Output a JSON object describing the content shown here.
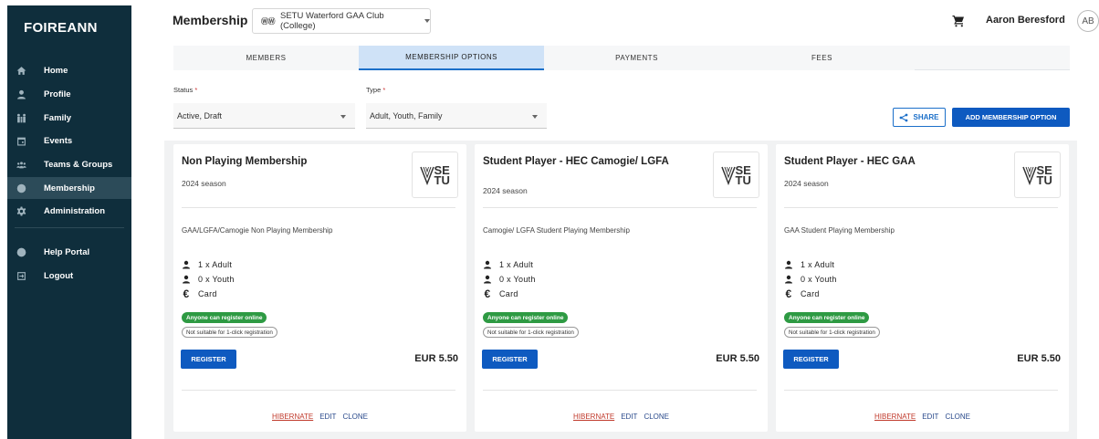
{
  "app": {
    "brand": "FOIREANN"
  },
  "sidebar": {
    "items": [
      {
        "label": "Home",
        "icon": "home-icon"
      },
      {
        "label": "Profile",
        "icon": "person-icon"
      },
      {
        "label": "Family",
        "icon": "family-icon"
      },
      {
        "label": "Events",
        "icon": "calendar-icon"
      },
      {
        "label": "Teams & Groups",
        "icon": "group-icon"
      },
      {
        "label": "Membership",
        "icon": "membership-icon",
        "active": true
      },
      {
        "label": "Administration",
        "icon": "gear-icon"
      },
      {
        "label": "Help Portal",
        "icon": "help-icon"
      },
      {
        "label": "Logout",
        "icon": "logout-icon"
      }
    ]
  },
  "header": {
    "title": "Membership",
    "club": "SETU Waterford GAA Club (College)",
    "user_name": "Aaron Beresford",
    "user_initials": "AB"
  },
  "tabs": [
    {
      "label": "MEMBERS"
    },
    {
      "label": "MEMBERSHIP OPTIONS",
      "active": true
    },
    {
      "label": "PAYMENTS"
    },
    {
      "label": "FEES"
    }
  ],
  "filters": {
    "status_label": "Status",
    "status_value": "Active, Draft",
    "type_label": "Type",
    "type_value": "Adult, Youth, Family",
    "required_mark": "*"
  },
  "actions": {
    "share_label": "SHARE",
    "add_label": "ADD MEMBERSHIP OPTION"
  },
  "cards": [
    {
      "title": "Non Playing Membership",
      "season": "2024 season",
      "description": "GAA/LGFA/Camogie Non Playing Membership",
      "adult": "1 x Adult",
      "youth": "0 x Youth",
      "payment": "Card",
      "badge_online": "Anyone can register online",
      "badge_oneclick": "Not suitable for 1-click registration",
      "register_label": "REGISTER",
      "price": "EUR 5.50",
      "hibernate": "HIBERNATE",
      "edit": "EDIT",
      "clone": "CLONE",
      "logo": "SETU"
    },
    {
      "title": "Student Player - HEC Camogie/ LGFA",
      "season": "2024 season",
      "description": "Camogie/ LGFA Student Playing Membership",
      "adult": "1 x Adult",
      "youth": "0 x Youth",
      "payment": "Card",
      "badge_online": "Anyone can register online",
      "badge_oneclick": "Not suitable for 1-click registration",
      "register_label": "REGISTER",
      "price": "EUR 5.50",
      "hibernate": "HIBERNATE",
      "edit": "EDIT",
      "clone": "CLONE",
      "logo": "SETU"
    },
    {
      "title": "Student Player - HEC GAA",
      "season": "2024 season",
      "description": "GAA Student Playing Membership",
      "adult": "1 x Adult",
      "youth": "0 x Youth",
      "payment": "Card",
      "badge_online": "Anyone can register online",
      "badge_oneclick": "Not suitable for 1-click registration",
      "register_label": "REGISTER",
      "price": "EUR 5.50",
      "hibernate": "HIBERNATE",
      "edit": "EDIT",
      "clone": "CLONE",
      "logo": "SETU"
    }
  ],
  "colors": {
    "sidebar_bg": "#0f2e3c",
    "primary": "#0e5ac0",
    "success": "#2e9a43",
    "danger": "#c0392b"
  }
}
